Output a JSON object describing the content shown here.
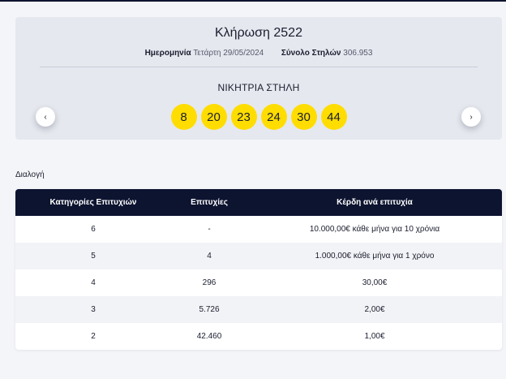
{
  "draw": {
    "title": "Κλήρωση 2522",
    "date_label": "Ημερομηνία",
    "date_value": "Τετάρτη 29/05/2024",
    "columns_label": "Σύνολο Στηλών",
    "columns_value": "306.953",
    "winning_label": "ΝΙΚΗΤΡΙΑ ΣΤΗΛΗ",
    "numbers": [
      "8",
      "20",
      "23",
      "24",
      "30",
      "44"
    ],
    "prev_icon": "‹",
    "next_icon": "›"
  },
  "section": {
    "label": "Διαλογή"
  },
  "table": {
    "headers": [
      "Κατηγορίες Επιτυχιών",
      "Επιτυχίες",
      "Κέρδη ανά επιτυχία"
    ],
    "rows": [
      [
        "6",
        "-",
        "10.000,00€ κάθε μήνα για 10 χρόνια"
      ],
      [
        "5",
        "4",
        "1.000,00€ κάθε μήνα για 1 χρόνο"
      ],
      [
        "4",
        "296",
        "30,00€"
      ],
      [
        "3",
        "5.726",
        "2,00€"
      ],
      [
        "2",
        "42.460",
        "1,00€"
      ]
    ]
  },
  "colors": {
    "accent_navy": "#0d1430",
    "ball_yellow": "#ffdd00",
    "card_bg": "#e6e8ef"
  }
}
